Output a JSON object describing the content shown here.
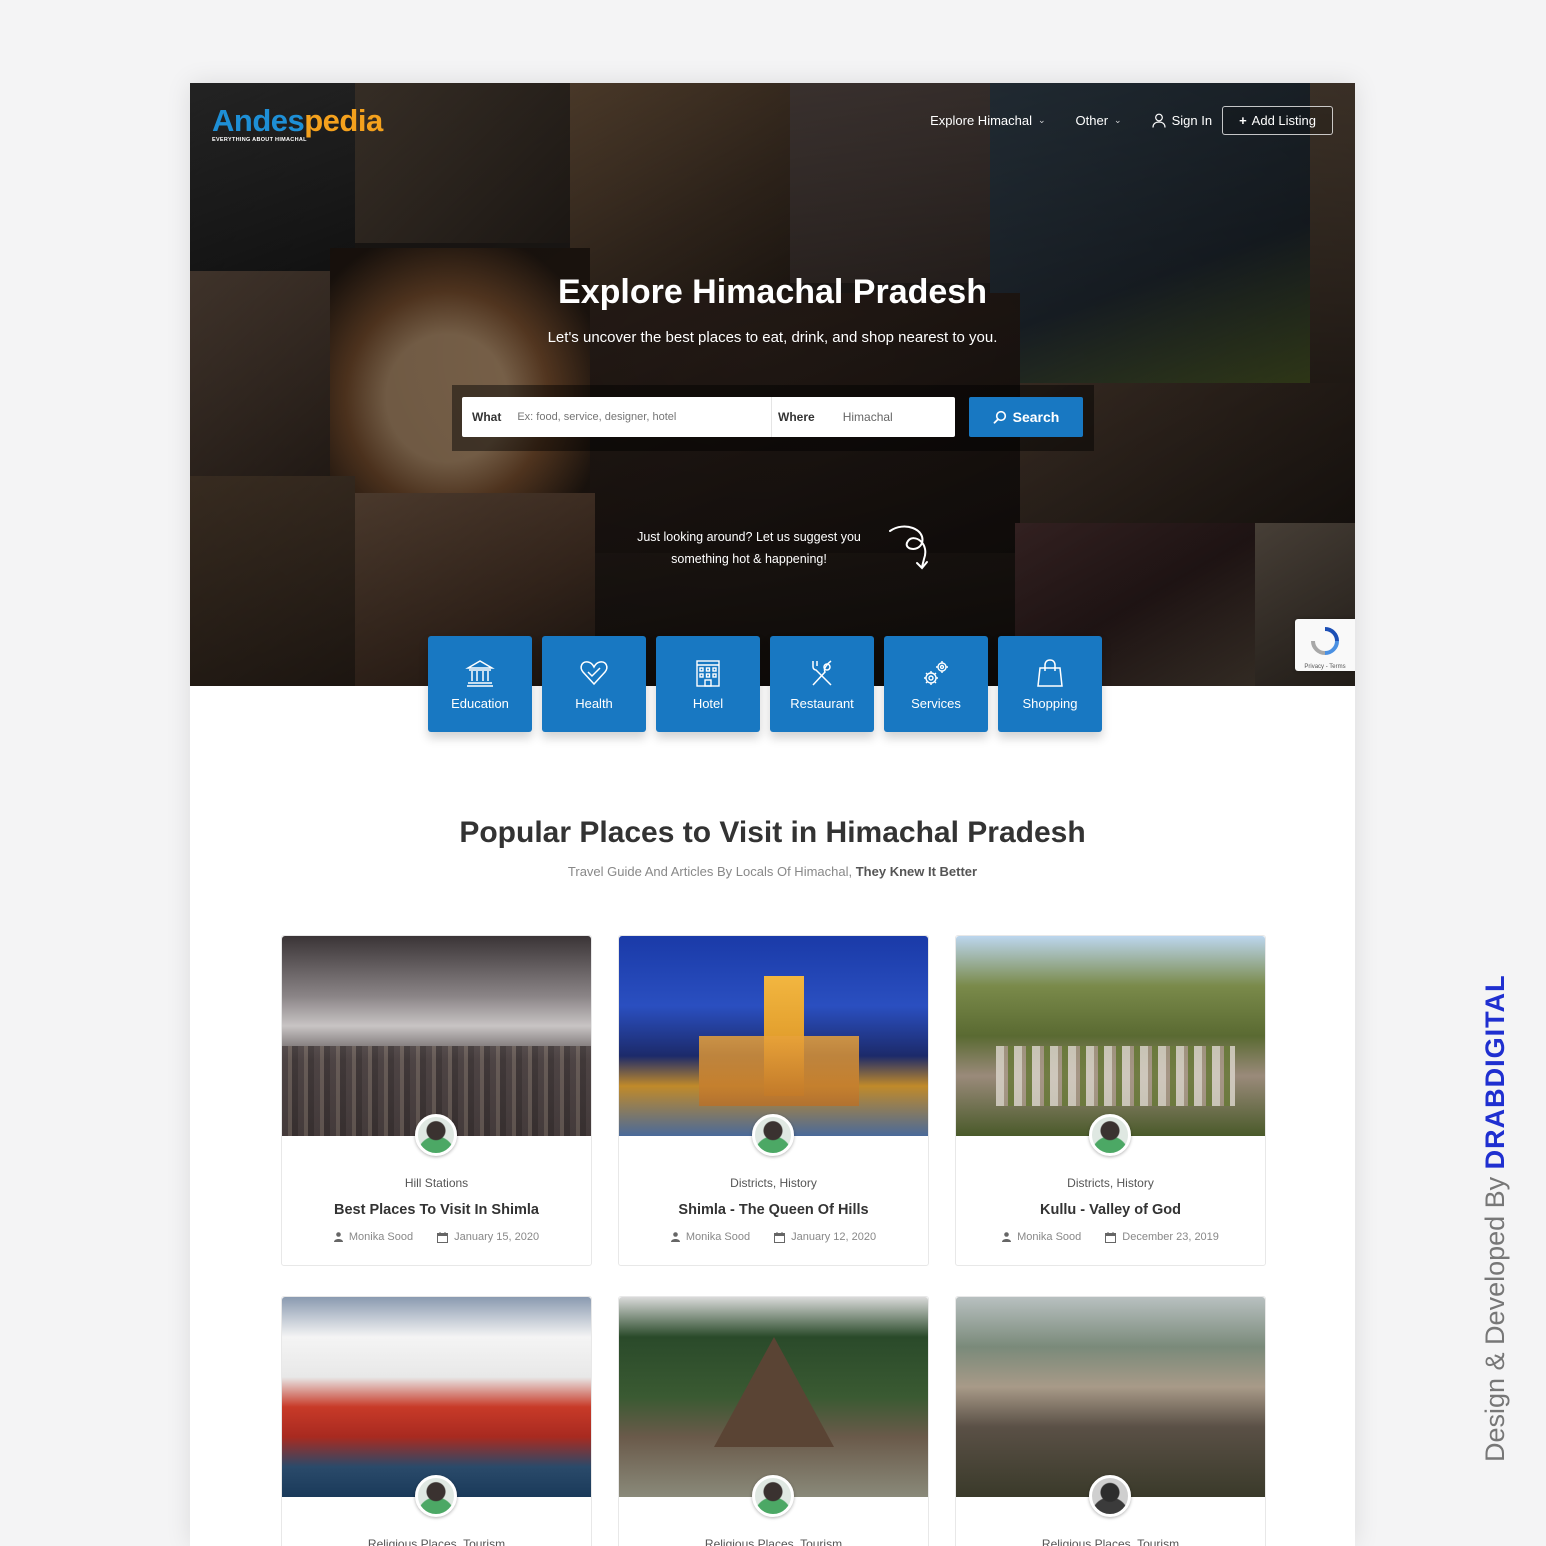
{
  "logo": {
    "part1": "Andes",
    "part2": "pedia",
    "tagline": "EVERYTHING ABOUT HIMACHAL"
  },
  "nav": {
    "explore": "Explore Himachal",
    "other": "Other",
    "signin": "Sign In",
    "add_listing": "Add Listing"
  },
  "hero": {
    "title": "Explore Himachal Pradesh",
    "subtitle": "Let's uncover the best places to eat, drink, and shop nearest to you.",
    "search": {
      "what_label": "What",
      "what_placeholder": "Ex: food, service, designer, hotel",
      "where_label": "Where",
      "where_value": "Himachal",
      "button": "Search"
    },
    "suggest_line1": "Just looking around? Let us suggest you",
    "suggest_line2": "something hot & happening!",
    "recaptcha_text": "Privacy - Terms"
  },
  "categories": [
    {
      "label": "Education",
      "icon": "bank-icon"
    },
    {
      "label": "Health",
      "icon": "heart-icon"
    },
    {
      "label": "Hotel",
      "icon": "building-icon"
    },
    {
      "label": "Restaurant",
      "icon": "fork-knife-icon"
    },
    {
      "label": "Services",
      "icon": "gears-icon"
    },
    {
      "label": "Shopping",
      "icon": "bag-icon"
    }
  ],
  "section": {
    "title": "Popular Places to Visit in Himachal Pradesh",
    "subtitle_plain": "Travel Guide And Articles By Locals Of Himachal,",
    "subtitle_bold": "They Knew It Better"
  },
  "cards": [
    {
      "category": "Hill Stations",
      "title": "Best Places To Visit In Shimla",
      "author": "Monika Sood",
      "date": "January 15, 2020"
    },
    {
      "category": "Districts, History",
      "title": "Shimla - The Queen Of Hills",
      "author": "Monika Sood",
      "date": "January 12, 2020"
    },
    {
      "category": "Districts, History",
      "title": "Kullu - Valley of God",
      "author": "Monika Sood",
      "date": "December 23, 2019"
    },
    {
      "category": "Religious Places, Tourism"
    },
    {
      "category": "Religious Places, Tourism"
    },
    {
      "category": "Religious Places, Tourism"
    }
  ],
  "credit": {
    "prefix": "Design & Developed By",
    "brand": "DRABDIGITAL"
  },
  "colors": {
    "primary": "#1878c2",
    "logo_blue": "#1e8fd6",
    "logo_orange": "#f4a11d",
    "credit_brand": "#1f2fd0"
  }
}
